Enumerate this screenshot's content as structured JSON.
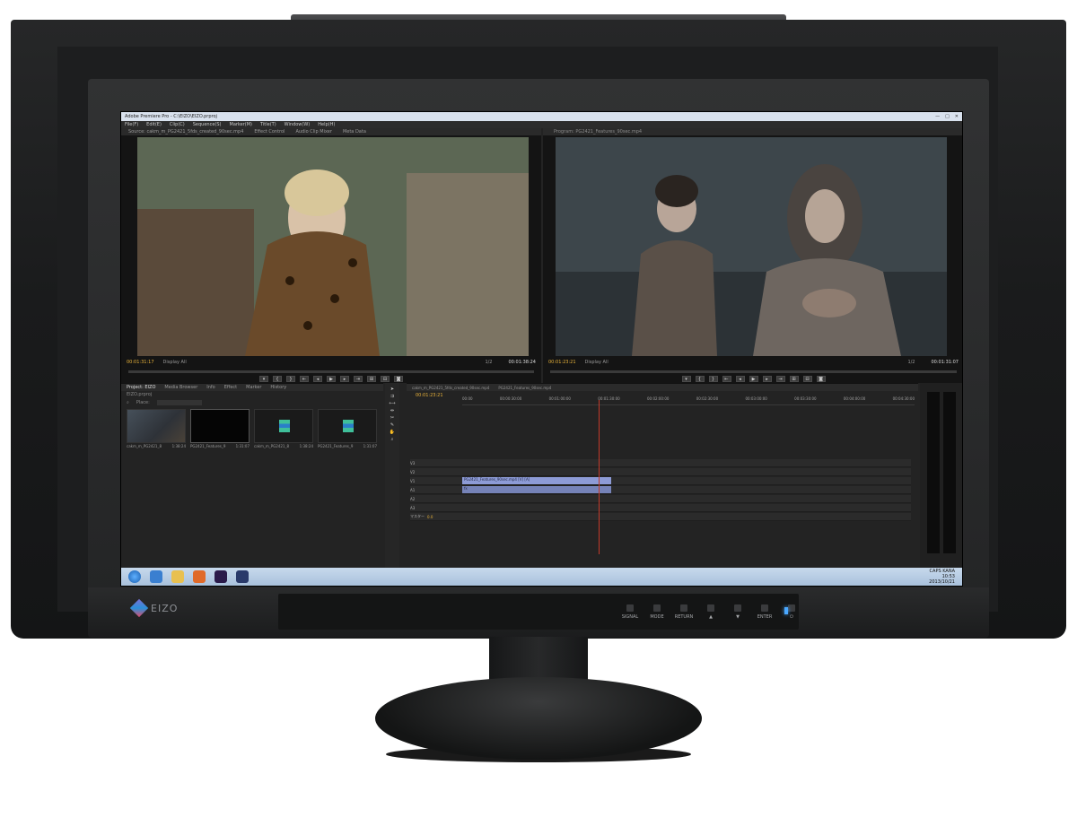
{
  "window": {
    "title": "Adobe Premiere Pro - C:\\EIZO\\EIZO.prproj",
    "controls": [
      "—",
      "□",
      "✕"
    ]
  },
  "menu": [
    "File(F)",
    "Edit(E)",
    "Clip(C)",
    "Sequence(S)",
    "Marker(M)",
    "Title(T)",
    "Window(W)",
    "Help(H)"
  ],
  "source_tabs": [
    "Source: cakm_m_PG2421_5fds_created_90sec.mp4",
    "Effect Control",
    "Audio Clip Mixer",
    "Meta Data"
  ],
  "program_tab": "Program: PG2421_Features_90sec.mp4",
  "source": {
    "timecode_in": "00:01:31:17",
    "display": "Display All",
    "fraction": "1/2",
    "timecode_out": "00:01:38:24"
  },
  "program": {
    "timecode_in": "00:01:23:21",
    "display": "Display All",
    "fraction": "1/2",
    "timecode_out": "00:01:31:07"
  },
  "media_browser_label": "Media Browser",
  "project": {
    "tabs": [
      "Project: EIZO",
      "Media Browser",
      "Info",
      "Effect",
      "Marker",
      "History"
    ],
    "file": "EIZO.prproj",
    "place_label": "Place:",
    "bins": [
      {
        "name": "cakm_m_PG2421_8",
        "dur": "1:38:24"
      },
      {
        "name": "PG2421_Features_9",
        "dur": "1:31:07"
      },
      {
        "name": "cakm_m_PG2421_8",
        "dur": "1:38:24"
      },
      {
        "name": "PG2421_Features_9",
        "dur": "1:31:07"
      }
    ]
  },
  "timeline": {
    "tabs": [
      "cakm_m_PG2421_5fds_created_90sec.mp4",
      "PG2421_Features_90sec.mp4"
    ],
    "timecode": "00:01:23:21",
    "ruler": [
      "00:00",
      "00:00:30:00",
      "00:01:00:00",
      "00:01:30:00",
      "00:02:00:00",
      "00:02:30:00",
      "00:03:00:00",
      "00:03:30:00",
      "00:04:00:00",
      "00:04:30:00"
    ],
    "tracks": [
      "V3",
      "V2",
      "V1",
      "A1",
      "A2",
      "A3"
    ],
    "master": "マスター",
    "master_val": "0.0",
    "video_clip": "PG2421_Features_90sec.mp4 [V] [A]",
    "audio_clip": "fx"
  },
  "tray": {
    "time": "10:53",
    "date": "2013/10/21",
    "lang": "CAPS KANA"
  },
  "hardware": {
    "brand": "EIZO",
    "buttons": [
      "SIGNAL",
      "MODE",
      "RETURN",
      "▲",
      "▼",
      "ENTER",
      "⏻"
    ]
  }
}
